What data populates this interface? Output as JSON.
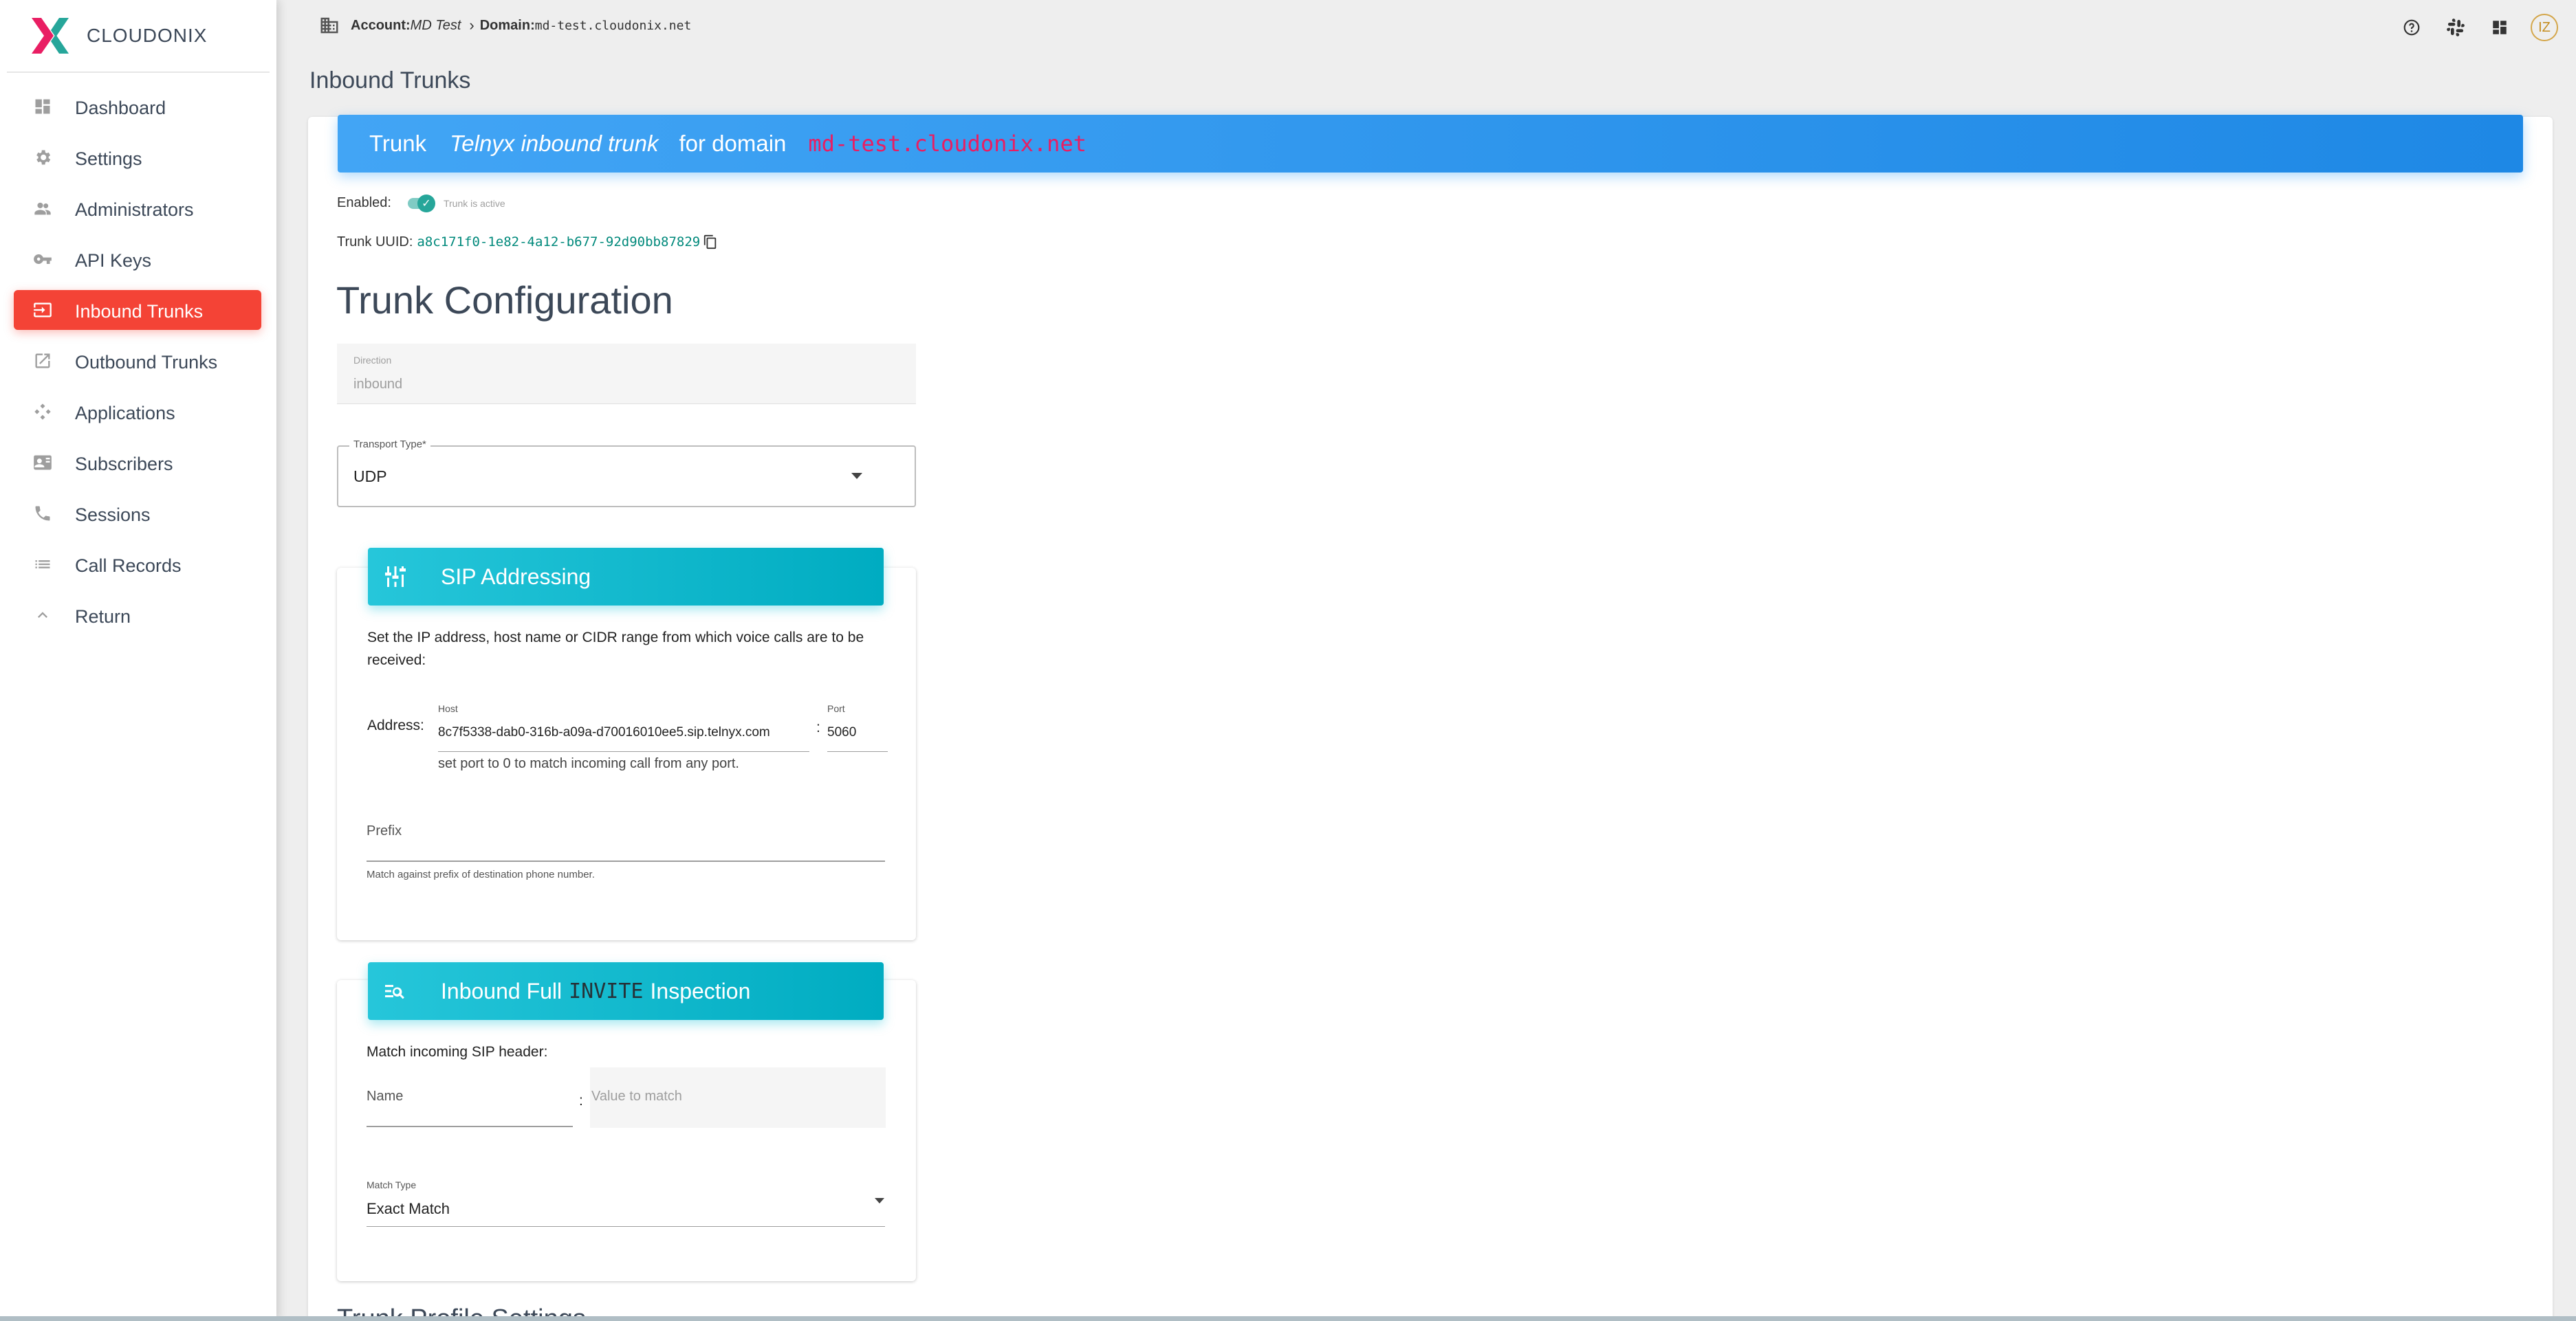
{
  "brand": {
    "name": "CLOUDONIX"
  },
  "sidebar": {
    "items": [
      {
        "label": "Dashboard",
        "icon": "dashboard-icon"
      },
      {
        "label": "Settings",
        "icon": "gear-icon"
      },
      {
        "label": "Administrators",
        "icon": "people-icon"
      },
      {
        "label": "API Keys",
        "icon": "key-icon"
      },
      {
        "label": "Inbound Trunks",
        "icon": "input-icon",
        "active": true
      },
      {
        "label": "Outbound Trunks",
        "icon": "open-external-icon"
      },
      {
        "label": "Applications",
        "icon": "diamond-arrows-icon"
      },
      {
        "label": "Subscribers",
        "icon": "contact-card-icon"
      },
      {
        "label": "Sessions",
        "icon": "phone-icon"
      },
      {
        "label": "Call Records",
        "icon": "list-icon"
      },
      {
        "label": "Return",
        "icon": "chevron-up-icon"
      }
    ]
  },
  "breadcrumb": {
    "account_label": "Account:",
    "account_name": "MD Test",
    "domain_label": "Domain:",
    "domain_name": "md-test.cloudonix.net"
  },
  "topbar": {
    "icons": [
      "help-icon",
      "slack-icon",
      "widgets-icon"
    ],
    "avatar_initials": "IZ"
  },
  "page": {
    "title": "Inbound Trunks"
  },
  "trunk_header": {
    "prefix": "Trunk",
    "name": "Telnyx inbound trunk",
    "middle": "for domain",
    "domain": "md-test.cloudonix.net"
  },
  "enabled": {
    "label": "Enabled:",
    "state_text": "Trunk is active",
    "on": true
  },
  "uuid": {
    "label": "Trunk UUID:",
    "value": "a8c171f0-1e82-4a12-b677-92d90bb87829"
  },
  "config": {
    "title": "Trunk Configuration",
    "direction": {
      "label": "Direction",
      "value": "inbound"
    },
    "transport": {
      "label": "Transport Type*",
      "value": "UDP"
    }
  },
  "sip": {
    "title": "SIP Addressing",
    "description": "Set the IP address, host name or CIDR range from which voice calls are to be received:",
    "address_label": "Address:",
    "host_label": "Host",
    "host_value": "8c7f5338-dab0-316b-a09a-d70016010ee5.sip.telnyx.com",
    "colon": ":",
    "port_label": "Port",
    "port_value": "5060",
    "port_help": "set port to 0 to match incoming call from any port.",
    "prefix_label": "Prefix",
    "prefix_help": "Match against prefix of destination phone number."
  },
  "invite": {
    "title_start": "Inbound Full",
    "title_mono": "INVITE",
    "title_end": "Inspection",
    "match_header_text": "Match incoming SIP header:",
    "name_label": "Name",
    "colon": ":",
    "value_placeholder": "Value to match",
    "match_type_label": "Match Type",
    "match_type_value": "Exact Match"
  },
  "next_section": {
    "title": "Trunk Profile Settings"
  },
  "colors": {
    "active_nav": "#f44336",
    "header_blue": "#1e88e5",
    "section_cyan": "#00acc1",
    "domain_pink": "#e91e63",
    "uuid_teal": "#00897b"
  }
}
